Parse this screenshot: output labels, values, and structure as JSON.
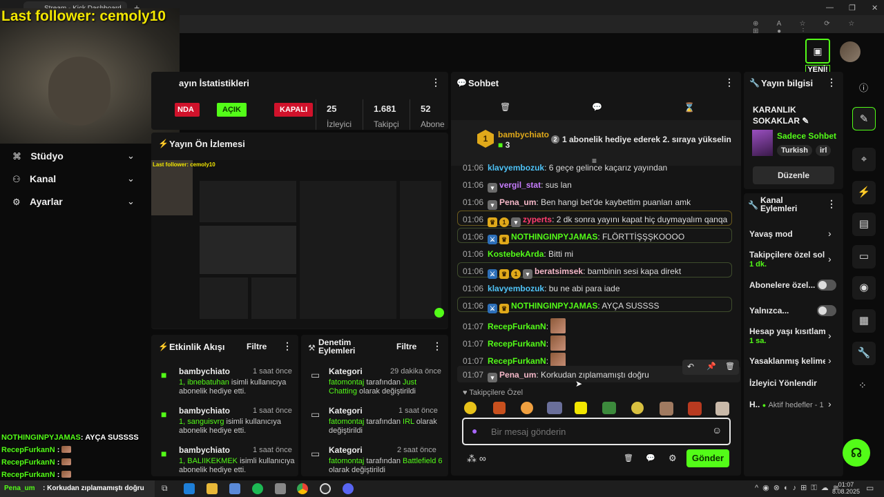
{
  "browser": {
    "tab_title": "Stream - Kick Dashboard",
    "new_tab": "+",
    "controls": {
      "minimize": "—",
      "maximize": "❐",
      "close": "✕"
    }
  },
  "overlay": {
    "last_follower": "Last follower: cemoly10",
    "bottom_chat": [
      {
        "user": "NOTHINGINPYJAMAS",
        "text": ": AYÇA SUSSSS"
      },
      {
        "user": "RecepFurkanN",
        "text": " :"
      },
      {
        "user": "RecepFurkanN",
        "text": " :"
      },
      {
        "user": "RecepFurkanN",
        "text": " :"
      },
      {
        "user": "Pena_um",
        "text": " : Korkudan zıplamamıştı doğru"
      }
    ]
  },
  "header": {
    "new_badge": "YENİ!"
  },
  "left_nav": [
    {
      "label": "Stüdyo",
      "icon": "studio-icon"
    },
    {
      "label": "Kanal",
      "icon": "channel-icon"
    },
    {
      "label": "Ayarlar",
      "icon": "gear-icon"
    }
  ],
  "stats": {
    "title": "ayın İstatistikleri",
    "pills": [
      "NDA",
      "AÇIK",
      "KAPALI"
    ],
    "values": [
      {
        "num": "25",
        "label": "İzleyici"
      },
      {
        "num": "1.681",
        "label": "Takipçi"
      },
      {
        "num": "52",
        "label": "Abone"
      }
    ]
  },
  "preview": {
    "title": "Yayın Ön İzlemesi",
    "mini_follower": "Last follower: cemoly10"
  },
  "events": {
    "title": "Etkinlik Akışı",
    "filter": "Filtre",
    "items": [
      {
        "user": "bambychiato",
        "time": "1 saat önce",
        "count": "1,",
        "name": "ibnebatuhan",
        "rest": " isimli kullanıcıya abonelik hediye etti."
      },
      {
        "user": "bambychiato",
        "time": "1 saat önce",
        "count": "1,",
        "name": "sanguisvrg",
        "rest": " isimli kullanıcıya abonelik hediye etti."
      },
      {
        "user": "bambychiato",
        "time": "1 saat önce",
        "count": "1,",
        "name": "BALIIKEKMEK",
        "rest": " isimli kullanıcıya abonelik hediye etti."
      }
    ]
  },
  "moderation": {
    "title": "Denetim Eylemleri",
    "filter": "Filtre",
    "items": [
      {
        "title": "Kategori",
        "time": "29 dakika önce",
        "actor": "fatomontaj",
        "mid": " tarafından ",
        "value": "Just Chatting",
        "end": " olarak değiştirildi"
      },
      {
        "title": "Kategori",
        "time": "1 saat önce",
        "actor": "fatomontaj",
        "mid": " tarafından ",
        "value": "IRL",
        "end": " olarak değiştirildi"
      },
      {
        "title": "Kategori",
        "time": "2 saat önce",
        "actor": "fatomontaj",
        "mid": " tarafından ",
        "value": "Battlefield 6",
        "end": " olarak değiştirildi"
      }
    ]
  },
  "chat": {
    "title": "Sohbet",
    "pinned_user": "bambychiato",
    "pinned_count": "3",
    "pinned_rank": "1",
    "pinned_text": "1 abonelik hediye ederek 2. sıraya yükselin",
    "pinned_text_rank": "2",
    "messages": [
      {
        "time": "01:06",
        "user": "klavyembozuk",
        "text": ": 6 geçe gelince kaçarız yayından",
        "color": "#4fc3f7"
      },
      {
        "time": "01:06",
        "user": "vergil_stat",
        "text": ": sus lan",
        "color": "#c77dff"
      },
      {
        "time": "01:06",
        "user": "Pena_um",
        "text": ": Ben hangi bet'de kaybettim puanları amk",
        "color": "#f5b8c8"
      },
      {
        "time": "01:06",
        "user": "zyperts",
        "text": ": 2 dk sonra yayını kapat hiç duymayalım qanqa",
        "color": "#ff3d6e"
      },
      {
        "time": "01:06",
        "user": "NOTHINGINPYJAMAS",
        "text": ": FLÖRTTİŞŞŞKOOOO",
        "color": "#53fc18"
      },
      {
        "time": "01:06",
        "user": "KostebekArda",
        "text": ": Bitti mi",
        "color": "#53fc18"
      },
      {
        "time": "01:06",
        "user": "beratsimsek",
        "text": ": bambinin sesi kapa direkt",
        "color": "#f5b8c8"
      },
      {
        "time": "01:06",
        "user": "klavyembozuk",
        "text": ": bu ne abi para iade",
        "color": "#4fc3f7"
      },
      {
        "time": "01:06",
        "user": "NOTHINGINPYJAMAS",
        "text": ": AYÇA SUSSSS",
        "color": "#53fc18"
      },
      {
        "time": "01:07",
        "user": "RecepFurkanN",
        "text": ":",
        "color": "#53fc18"
      },
      {
        "time": "01:07",
        "user": "RecepFurkanN",
        "text": ":",
        "color": "#53fc18"
      },
      {
        "time": "01:07",
        "user": "RecepFurkanN",
        "text": ":",
        "color": "#53fc18"
      },
      {
        "time": "01:07",
        "user": "Pena_um",
        "text": ": Korkudan zıplamamıştı doğru",
        "color": "#f5b8c8"
      }
    ],
    "followers_only": "Takipçilere Özel",
    "input_placeholder": "Bir mesaj gönderin",
    "send": "Gönder"
  },
  "stream_info": {
    "title": "Yayın bilgisi",
    "stream_title": "KARANLIK SOKAKLAR",
    "category": "Sadece Sohbet",
    "tags": [
      "Turkish",
      "irl"
    ],
    "edit": "Düzenle"
  },
  "channel_actions": {
    "title": "Kanal Eylemleri",
    "items": [
      {
        "label": "Yavaş mod",
        "sub": ""
      },
      {
        "label": "Takipçilere özel sol",
        "sub": "1 dk."
      },
      {
        "label": "Abonelere özel...",
        "sub": ""
      },
      {
        "label": "Yalnızca...",
        "sub": ""
      },
      {
        "label": "Hesap yaşı kısıtlam",
        "sub": "1 sa."
      },
      {
        "label": "Yasaklanmış kelime",
        "sub": ""
      },
      {
        "label": "İzleyici Yönlendir",
        "sub": ""
      },
      {
        "label": "H..",
        "sub": "Aktif hedefler - 1"
      }
    ]
  },
  "taskbar": {
    "time": "01:07",
    "date": "8.08.2025"
  }
}
